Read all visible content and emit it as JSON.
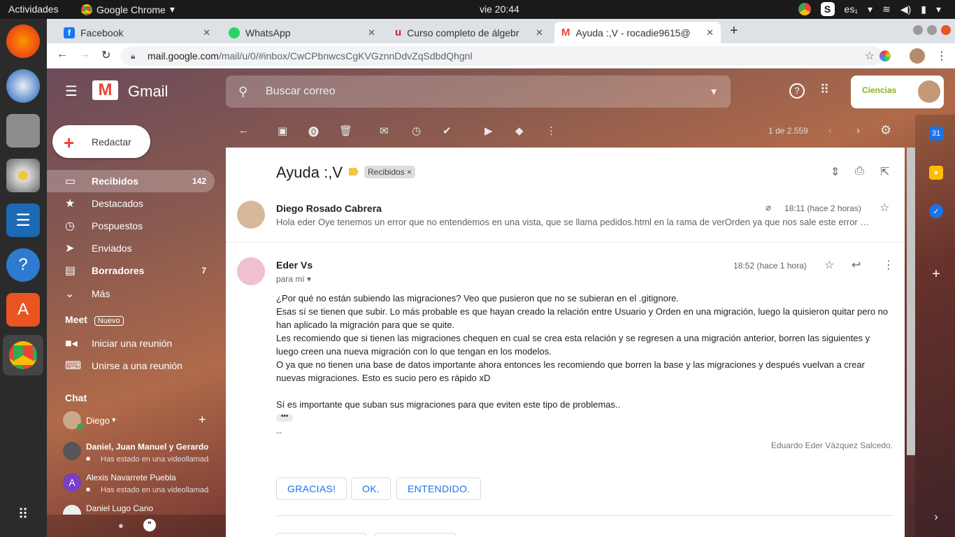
{
  "topbar": {
    "activities": "Actividades",
    "app_name": "Google Chrome",
    "clock": "vie 20:44",
    "lang": "es₁"
  },
  "tabs": [
    {
      "label": "Facebook"
    },
    {
      "label": "WhatsApp"
    },
    {
      "label": "Curso completo de álgebr"
    },
    {
      "label": "Ayuda :,V - rocadie9615@"
    }
  ],
  "address": {
    "host": "mail.google.com",
    "path": "/mail/u/0/#inbox/CwCPbnwcsCgKVGznnDdvZqSdbdQhgnl"
  },
  "gmail": {
    "logo": "Gmail",
    "search_placeholder": "Buscar correo",
    "compose": "Redactar",
    "nav": [
      {
        "label": "Recibidos",
        "count": "142"
      },
      {
        "label": "Destacados",
        "count": ""
      },
      {
        "label": "Pospuestos",
        "count": ""
      },
      {
        "label": "Enviados",
        "count": ""
      },
      {
        "label": "Borradores",
        "count": "7"
      },
      {
        "label": "Más",
        "count": ""
      }
    ],
    "meet": {
      "title": "Meet",
      "badge": "Nuevo",
      "items": [
        "Iniciar una reunión",
        "Unirse a una reunión"
      ]
    },
    "chat": {
      "title": "Chat",
      "me": "Diego",
      "contacts": [
        {
          "name": "Daniel, Juan Manuel y Gerardo",
          "status": "Has estado en una videollamada"
        },
        {
          "name": "Alexis Navarrete Puebla",
          "status": "Has estado en una videollamada"
        },
        {
          "name": "Daniel Lugo Cano",
          "status": ""
        }
      ]
    },
    "pagination": "1 de 2.559",
    "org_logo": "Ciencias"
  },
  "thread": {
    "subject": "Ayuda :,V",
    "label": "Recibidos",
    "messages": [
      {
        "sender": "Diego Rosado Cabrera",
        "time": "18:11 (hace 2 horas)",
        "snippet": "Hola eder Oye tenemos un error que no entendemos en una vista, que se llama pedidos.html en la rama de verOrden ya que nos sale este error …"
      },
      {
        "sender": "Eder Vs",
        "to": "para mí",
        "time": "18:52 (hace 1 hora)",
        "body": [
          "¿Por qué no están subiendo las migraciones? Veo que pusieron que no se subieran en el .gitignore.",
          "Esas sí se tienen que subir. Lo más probable es que hayan creado la relación entre Usuario y Orden en una migración, luego la quisieron quitar pero no han aplicado la migración para que se quite.",
          "Les recomiendo que si tienen las migraciones chequen en cual se crea esta relación y se regresen a una migración anterior, borren las siguientes y luego creen una nueva migración con lo que tengan en los modelos.",
          "O ya que no tienen una base de datos importante ahora entonces les recomiendo que borren la base y las migraciones y después vuelvan a crear nuevas migraciones. Esto es sucio pero es rápido xD",
          "Sí es importante que suban sus migraciones para que eviten este tipo de problemas.."
        ],
        "sig_sep": "--",
        "signature": "Eduardo Eder Vázquez Salcedo."
      }
    ],
    "smart_replies": [
      "GRACIAS!",
      "OK.",
      "ENTENDIDO."
    ]
  },
  "colors": {
    "gmail_red": "#ea4335",
    "link_blue": "#1a73e8"
  }
}
